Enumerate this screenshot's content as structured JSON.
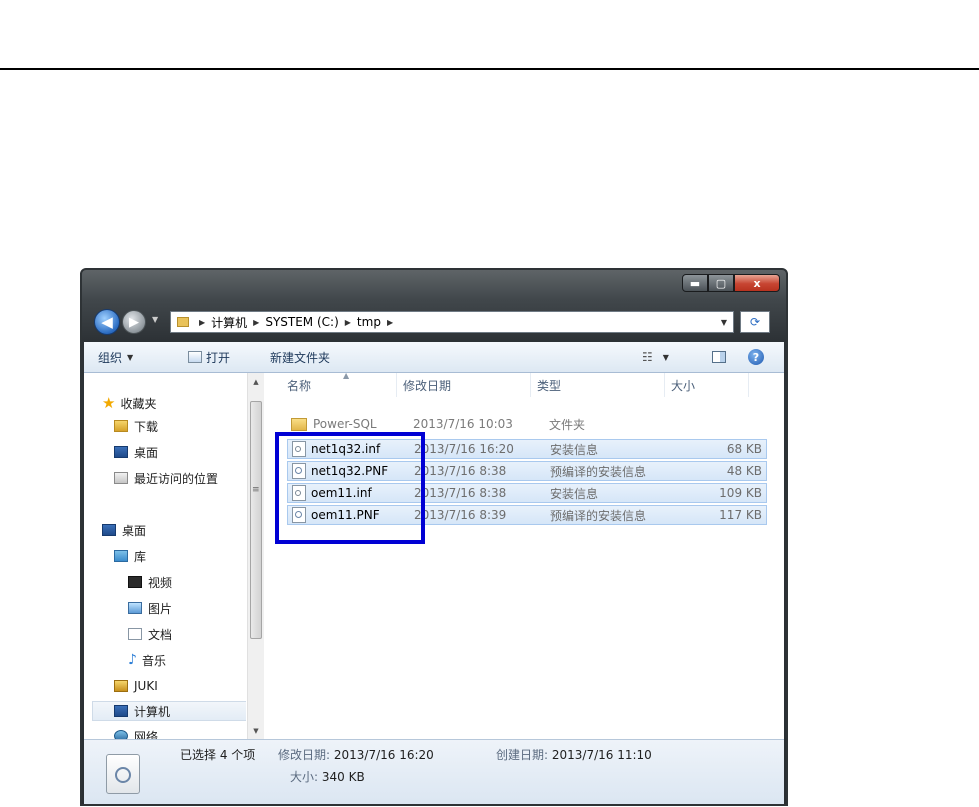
{
  "window": {
    "controls": {
      "minimize": "▬",
      "maximize": "▢",
      "close": "x"
    }
  },
  "navbar": {
    "back": "◀",
    "forward": "▶",
    "breadcrumb": [
      "计算机",
      "SYSTEM (C:)",
      "tmp"
    ],
    "refresh_icon": "⟳"
  },
  "toolbar": {
    "organize": "组织",
    "open": "打开",
    "new_folder": "新建文件夹",
    "help": "?"
  },
  "navpane": {
    "favorites": "收藏夹",
    "downloads": "下载",
    "desktop_fav": "桌面",
    "recent": "最近访问的位置",
    "desktop": "桌面",
    "libraries": "库",
    "videos": "视频",
    "pictures": "图片",
    "documents": "文档",
    "music": "音乐",
    "juki": "JUKI",
    "computer": "计算机",
    "network": "网络"
  },
  "columns": {
    "name": "名称",
    "date": "修改日期",
    "type": "类型",
    "size": "大小"
  },
  "files": [
    {
      "name": "Power-SQL",
      "date": "2013/7/16 10:03",
      "type": "文件夹",
      "size": "",
      "icon": "folder-icon",
      "selected": false
    },
    {
      "name": "net1q32.inf",
      "date": "2013/7/16 16:20",
      "type": "安装信息",
      "size": "68 KB",
      "icon": "inf-file-icon",
      "selected": true
    },
    {
      "name": "net1q32.PNF",
      "date": "2013/7/16 8:38",
      "type": "预编译的安装信息",
      "size": "48 KB",
      "icon": "pnf-file-icon",
      "selected": true
    },
    {
      "name": "oem11.inf",
      "date": "2013/7/16 8:38",
      "type": "安装信息",
      "size": "109 KB",
      "icon": "inf-file-icon",
      "selected": true
    },
    {
      "name": "oem11.PNF",
      "date": "2013/7/16 8:39",
      "type": "预编译的安装信息",
      "size": "117 KB",
      "icon": "pnf-file-icon",
      "selected": true
    }
  ],
  "details": {
    "selected_count": "已选择 4 个项",
    "modified_label": "修改日期:",
    "modified_value": "2013/7/16 16:20",
    "created_label": "创建日期:",
    "created_value": "2013/7/16 11:10",
    "size_label": "大小:",
    "size_value": "340 KB"
  },
  "colors": {
    "highlight_box": "#0000d4",
    "selection": "#d6e6f8",
    "accent": "#2b6cc2"
  }
}
